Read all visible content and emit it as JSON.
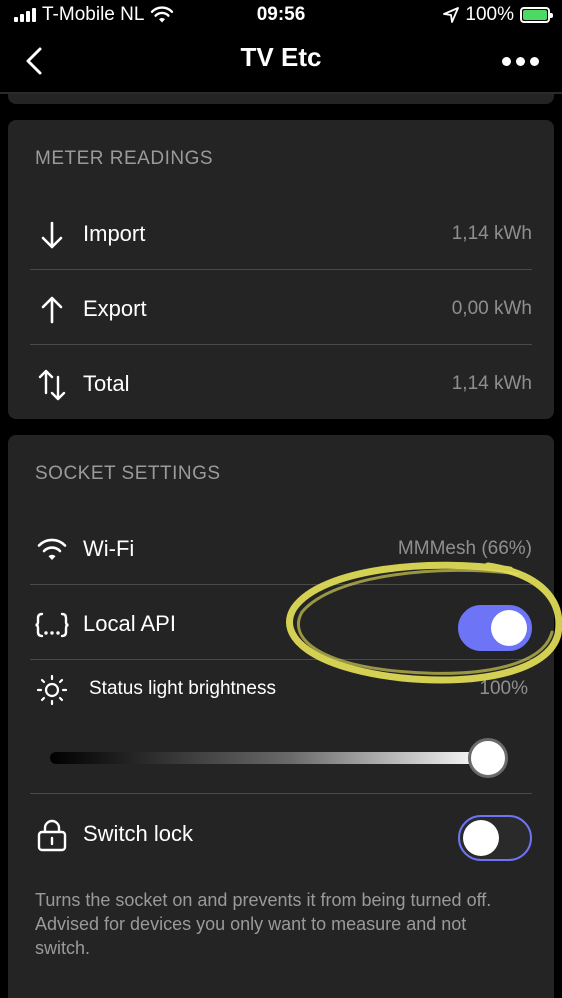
{
  "status_bar": {
    "carrier": "T-Mobile NL",
    "time": "09:56",
    "battery": "100%",
    "icons": [
      "signal-icon",
      "wifi-icon",
      "location-arrow-icon",
      "battery-charging-icon"
    ]
  },
  "nav": {
    "title": "TV Etc",
    "back_icon": "chevron-left-icon",
    "more_icon": "ellipsis-icon"
  },
  "meter_readings": {
    "title": "METER READINGS",
    "rows": [
      {
        "label": "Import",
        "value": "1,14 kWh",
        "icon": "arrow-down-icon"
      },
      {
        "label": "Export",
        "value": "0,00 kWh",
        "icon": "arrow-up-icon"
      },
      {
        "label": "Total",
        "value": "1,14 kWh",
        "icon": "arrows-up-down-icon"
      }
    ]
  },
  "socket_settings": {
    "title": "SOCKET SETTINGS",
    "wifi": {
      "label": "Wi-Fi",
      "value": "MMMesh (66%)",
      "icon": "wifi-icon"
    },
    "local_api": {
      "label": "Local API",
      "icon": "braces-icon",
      "enabled": true
    },
    "brightness": {
      "label": "Status light brightness",
      "value": "100%",
      "level": 1.0,
      "icon": "sun-icon"
    },
    "switch_lock": {
      "label": "Switch lock",
      "icon": "lock-icon",
      "enabled": false,
      "description": "Turns the socket on and prevents it from being turned off. Advised for devices you only want to measure and not switch."
    }
  },
  "colors": {
    "accent": "#6d74f5",
    "card_bg": "#242424",
    "secondary_text": "#9a9a9a",
    "annotation": "#e8e35a"
  }
}
